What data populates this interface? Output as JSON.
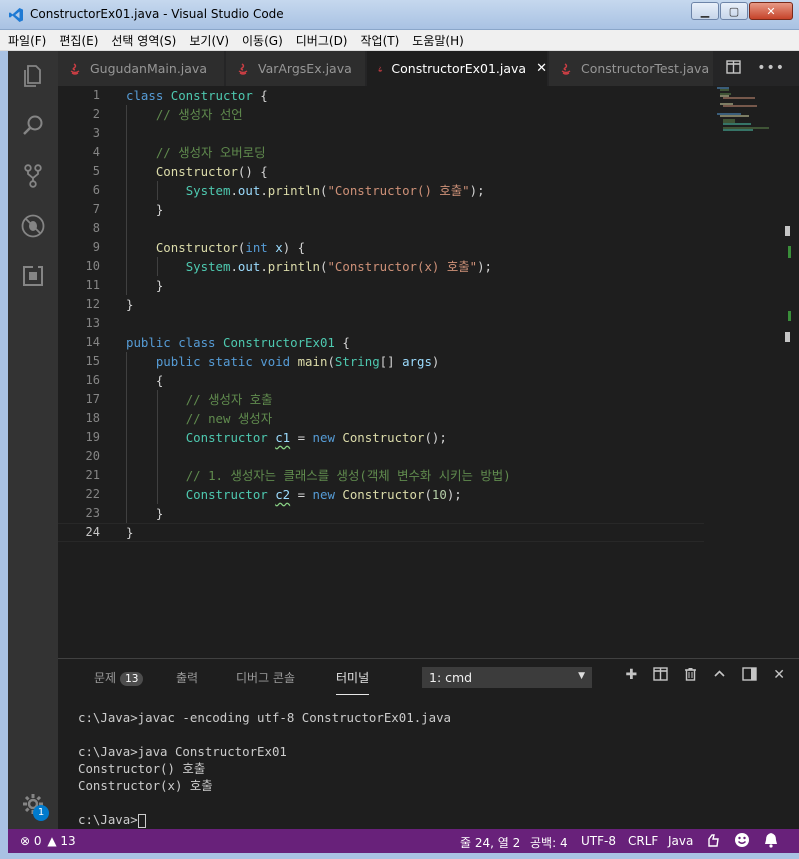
{
  "window": {
    "title": "ConstructorEx01.java - Visual Studio Code"
  },
  "menu": [
    "파일(F)",
    "편집(E)",
    "선택 영역(S)",
    "보기(V)",
    "이동(G)",
    "디버그(D)",
    "작업(T)",
    "도움말(H)"
  ],
  "tabs": [
    {
      "label": "GugudanMain.java",
      "active": false
    },
    {
      "label": "VarArgsEx.java",
      "active": false
    },
    {
      "label": "ConstructorEx01.java",
      "active": true
    },
    {
      "label": "ConstructorTest.java",
      "active": false
    }
  ],
  "editor": {
    "line_numbers": [
      "1",
      "2",
      "3",
      "4",
      "5",
      "6",
      "7",
      "8",
      "9",
      "10",
      "11",
      "12",
      "13",
      "14",
      "15",
      "16",
      "17",
      "18",
      "19",
      "20",
      "21",
      "22",
      "23",
      "24"
    ],
    "current_line": "24",
    "lines": [
      [
        [
          "kw",
          "class "
        ],
        [
          "ty",
          "Constructor "
        ],
        [
          "pl",
          "{"
        ]
      ],
      [
        [
          "pl",
          "    "
        ],
        [
          "cm",
          "// 생성자 선언"
        ]
      ],
      [],
      [
        [
          "pl",
          "    "
        ],
        [
          "cm",
          "// 생성자 오버로딩"
        ]
      ],
      [
        [
          "pl",
          "    "
        ],
        [
          "fn",
          "Constructor"
        ],
        [
          "pl",
          "() {"
        ]
      ],
      [
        [
          "pl",
          "        "
        ],
        [
          "ty",
          "System"
        ],
        [
          "pl",
          "."
        ],
        [
          "id",
          "out"
        ],
        [
          "pl",
          "."
        ],
        [
          "fn",
          "println"
        ],
        [
          "pl",
          "("
        ],
        [
          "st",
          "\"Constructor() 호출\""
        ],
        [
          "pl",
          ");"
        ]
      ],
      [
        [
          "pl",
          "    }"
        ]
      ],
      [],
      [
        [
          "pl",
          "    "
        ],
        [
          "fn",
          "Constructor"
        ],
        [
          "pl",
          "("
        ],
        [
          "kw",
          "int "
        ],
        [
          "id",
          "x"
        ],
        [
          "pl",
          ") {"
        ]
      ],
      [
        [
          "pl",
          "        "
        ],
        [
          "ty",
          "System"
        ],
        [
          "pl",
          "."
        ],
        [
          "id",
          "out"
        ],
        [
          "pl",
          "."
        ],
        [
          "fn",
          "println"
        ],
        [
          "pl",
          "("
        ],
        [
          "st",
          "\"Constructor(x) 호출\""
        ],
        [
          "pl",
          ");"
        ]
      ],
      [
        [
          "pl",
          "    }"
        ]
      ],
      [
        [
          "pl",
          "}"
        ]
      ],
      [],
      [
        [
          "kw",
          "public class "
        ],
        [
          "ty",
          "ConstructorEx01 "
        ],
        [
          "pl",
          "{"
        ]
      ],
      [
        [
          "pl",
          "    "
        ],
        [
          "kw",
          "public static void "
        ],
        [
          "fn",
          "main"
        ],
        [
          "pl",
          "("
        ],
        [
          "ty",
          "String"
        ],
        [
          "pl",
          "[] "
        ],
        [
          "id",
          "args"
        ],
        [
          "pl",
          ")"
        ]
      ],
      [
        [
          "pl",
          "    {"
        ]
      ],
      [
        [
          "pl",
          "        "
        ],
        [
          "cm",
          "// 생성자 호출"
        ]
      ],
      [
        [
          "pl",
          "        "
        ],
        [
          "cm",
          "// new 생성자"
        ]
      ],
      [
        [
          "pl",
          "        "
        ],
        [
          "ty",
          "Constructor "
        ],
        [
          "idsq",
          "c1"
        ],
        [
          "pl",
          " = "
        ],
        [
          "kw",
          "new "
        ],
        [
          "fn",
          "Constructor"
        ],
        [
          "pl",
          "();"
        ]
      ],
      [],
      [
        [
          "pl",
          "        "
        ],
        [
          "cm",
          "// 1. 생성자는 클래스를 생성(객체 변수화 시키는 방법)"
        ]
      ],
      [
        [
          "pl",
          "        "
        ],
        [
          "ty",
          "Constructor "
        ],
        [
          "idsq",
          "c2"
        ],
        [
          "pl",
          " = "
        ],
        [
          "kw",
          "new "
        ],
        [
          "fn",
          "Constructor"
        ],
        [
          "pl",
          "("
        ],
        [
          "nm",
          "10"
        ],
        [
          "pl",
          ");"
        ]
      ],
      [
        [
          "pl",
          "    }"
        ]
      ],
      [
        [
          "pl",
          "}"
        ]
      ]
    ]
  },
  "panel": {
    "tabs": [
      {
        "label": "문제",
        "badge": "13"
      },
      {
        "label": "출력"
      },
      {
        "label": "디버그 콘솔"
      },
      {
        "label": "터미널",
        "active": true
      }
    ],
    "terminal_select": "1: cmd",
    "terminal_lines": [
      "c:\\Java>javac -encoding utf-8 ConstructorEx01.java",
      "",
      "c:\\Java>java ConstructorEx01",
      "Constructor() 호출",
      "Constructor(x) 호출",
      "",
      "c:\\Java>"
    ]
  },
  "activity": {
    "settings_badge": "1"
  },
  "status": {
    "errors": "0",
    "warnings": "13",
    "position": "줄 24, 열 2",
    "indent": "공백: 4",
    "encoding": "UTF-8",
    "eol": "CRLF",
    "language": "Java"
  },
  "colors": {
    "statusbar": "#68217a",
    "editor_bg": "#1e1e1e",
    "activitybar": "#333333"
  }
}
